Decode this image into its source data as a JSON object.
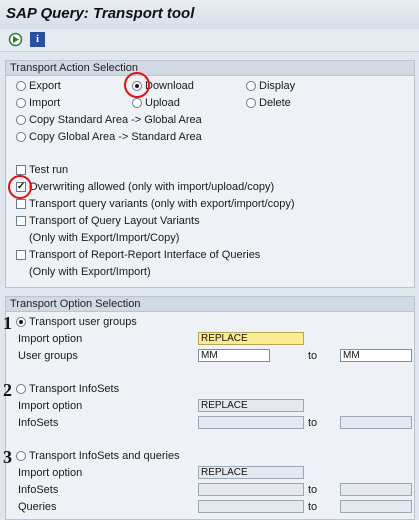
{
  "window": {
    "title": "SAP Query: Transport tool"
  },
  "toolbar": {
    "execute_icon": "execute-icon",
    "info_label": "i"
  },
  "action_panel": {
    "header": "Transport Action Selection",
    "radios": {
      "export": "Export",
      "download": "Download",
      "display": "Display",
      "import": "Import",
      "upload": "Upload",
      "delete": "Delete",
      "copy_std_global": "Copy Standard Area -> Global Area",
      "copy_global_std": "Copy Global Area -> Standard Area"
    },
    "selected": "download",
    "checks": {
      "test_run": "Test run",
      "overwriting": "Overwriting allowed (only with import/upload/copy)",
      "query_variants": "Transport query variants (only with export/import/copy)",
      "layout_variants": "Transport of Query Layout Variants",
      "layout_variants_note": "(Only with Export/Import/Copy)",
      "rri": "Transport of Report-Report Interface of Queries",
      "rri_note": "(Only with Export/Import)"
    },
    "overwriting_checked": true
  },
  "option_panel": {
    "header": "Transport Option Selection",
    "user_groups": {
      "radio_label": "Transport user groups",
      "import_option_label": "Import option",
      "import_option_value": "REPLACE",
      "groups_label": "User groups",
      "from": "MM",
      "to_label": "to",
      "to": "MM"
    },
    "infosets": {
      "radio_label": "Transport InfoSets",
      "import_option_label": "Import option",
      "import_option_value": "REPLACE",
      "infosets_label": "InfoSets",
      "to_label": "to"
    },
    "infosets_queries": {
      "radio_label": "Transport InfoSets and queries",
      "import_option_label": "Import option",
      "import_option_value": "REPLACE",
      "infosets_label": "InfoSets",
      "queries_label": "Queries",
      "to_label": "to",
      "to_label2": "to"
    }
  },
  "annotations": {
    "n1": "1",
    "n2": "2",
    "n3": "3"
  },
  "colors": {
    "annotation_red": "#dd1111",
    "highlight_field": "#fbeb92"
  }
}
